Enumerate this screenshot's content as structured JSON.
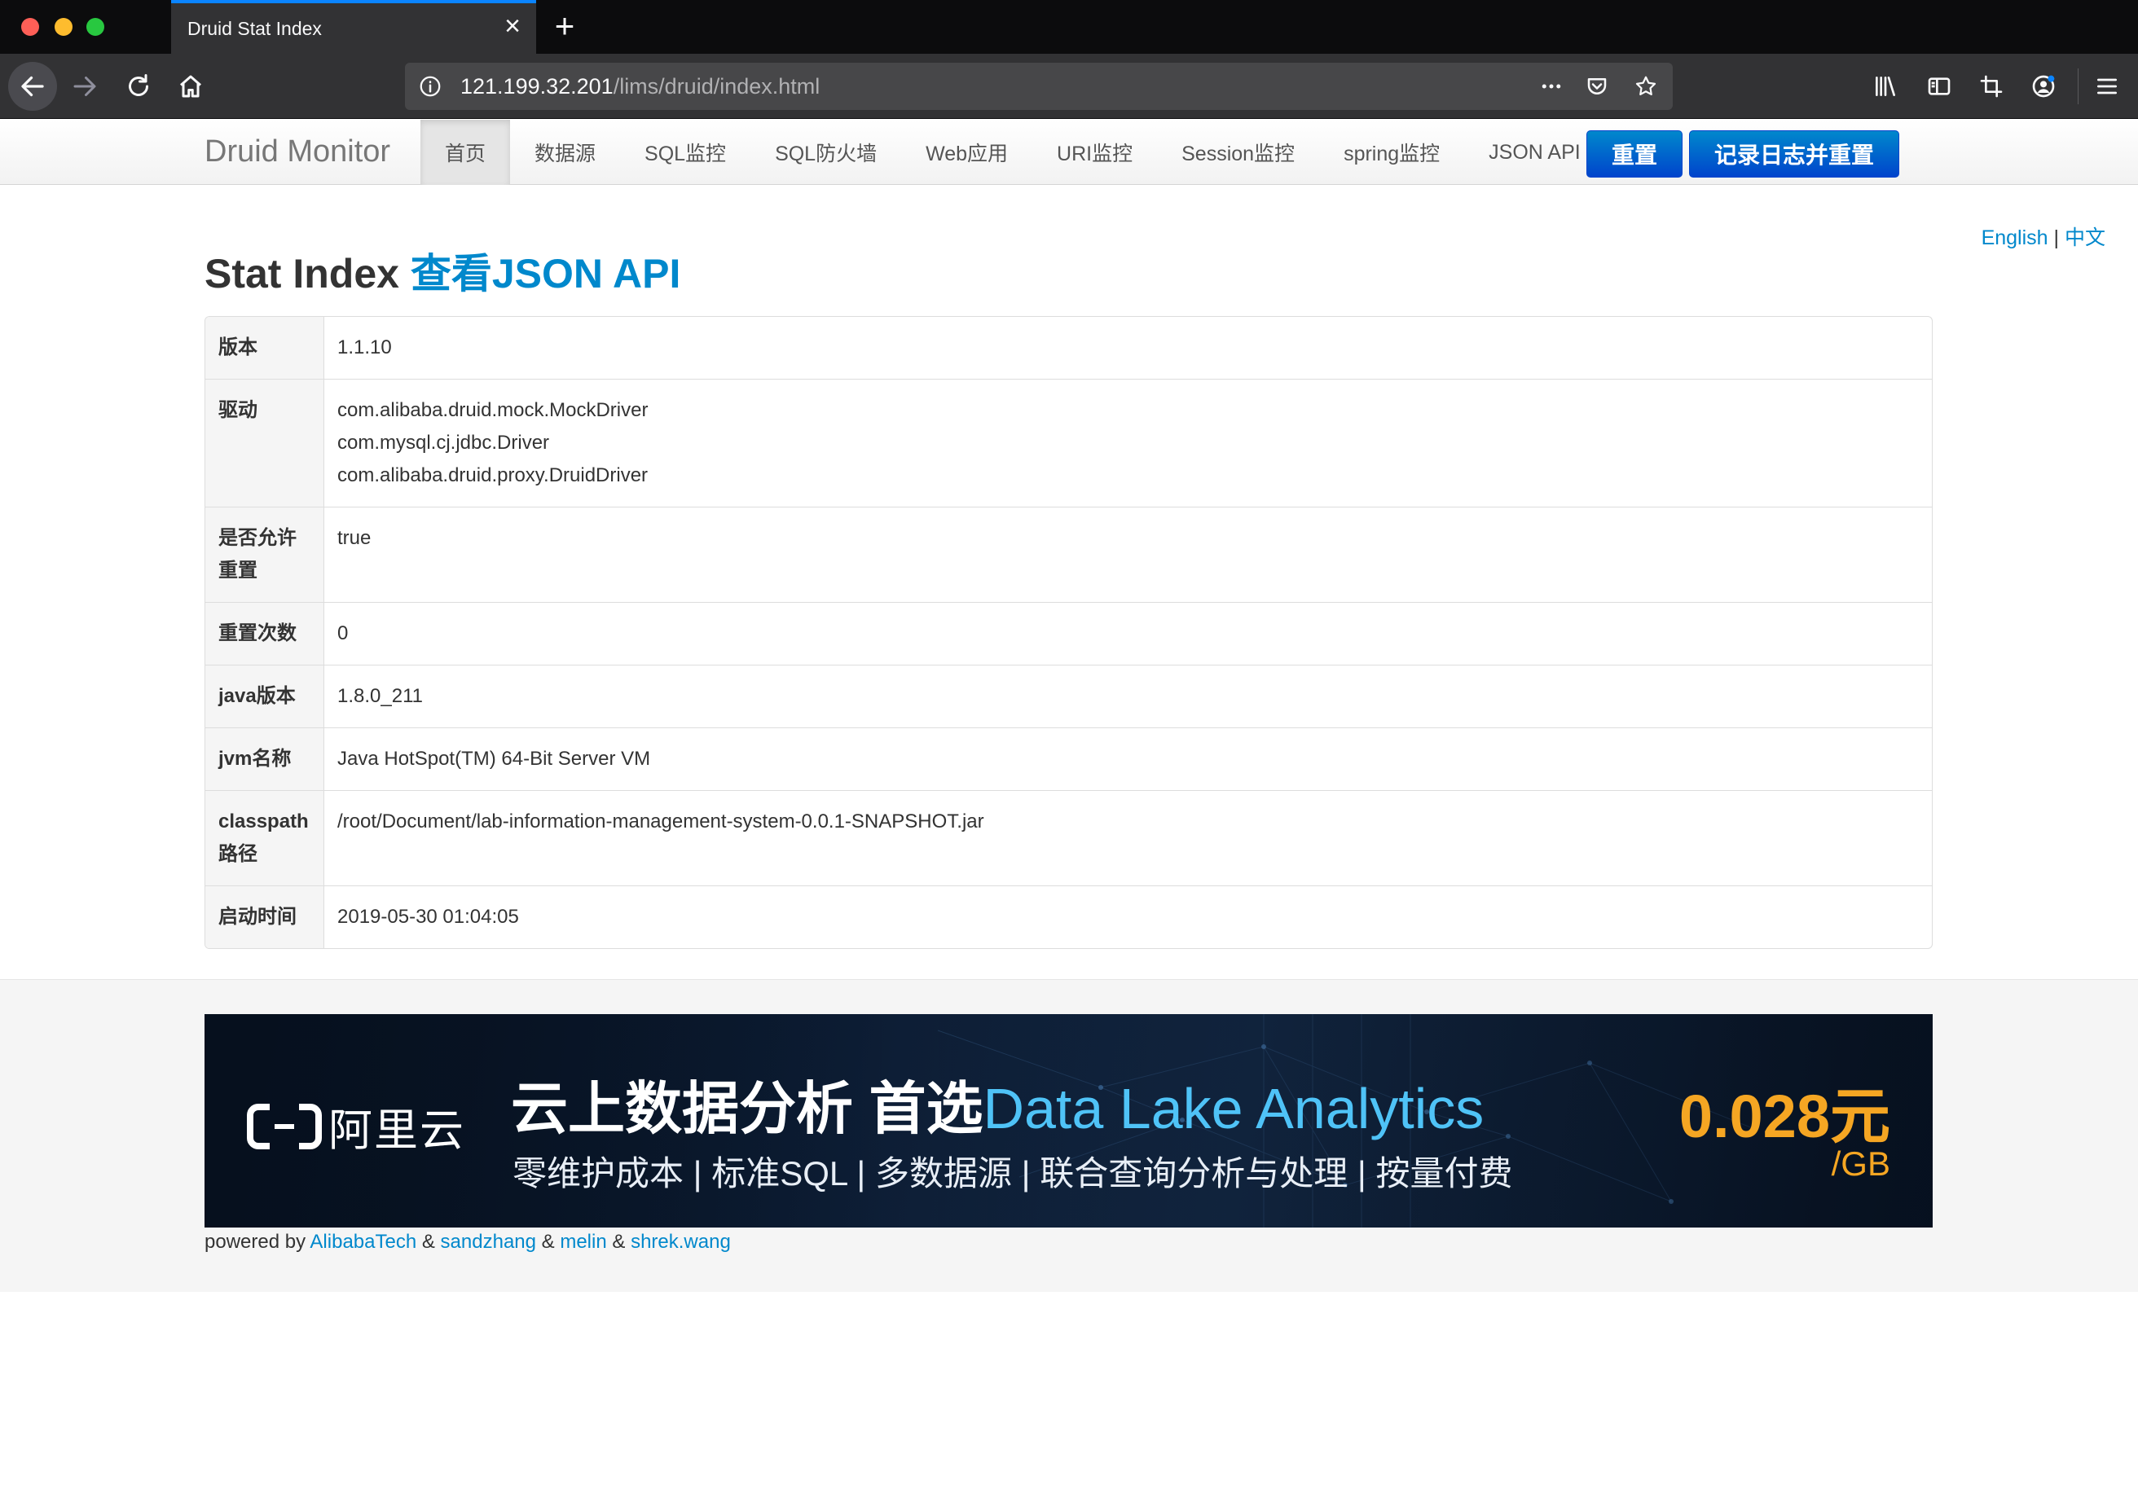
{
  "browser": {
    "tab_title": "Druid Stat Index",
    "url_host": "121.199.32.201",
    "url_path": "/lims/druid/index.html"
  },
  "site": {
    "brand": "Druid Monitor",
    "nav": [
      "首页",
      "数据源",
      "SQL监控",
      "SQL防火墙",
      "Web应用",
      "URI监控",
      "Session监控",
      "spring监控",
      "JSON API"
    ],
    "reset_label": "重置",
    "log_reset_label": "记录日志并重置"
  },
  "lang": {
    "english": "English",
    "separator": "|",
    "chinese": "中文"
  },
  "page": {
    "title_static": "Stat Index",
    "title_link": "查看JSON API"
  },
  "stats": [
    {
      "key": "版本",
      "values": [
        "1.1.10"
      ]
    },
    {
      "key": "驱动",
      "values": [
        "com.alibaba.druid.mock.MockDriver",
        "com.mysql.cj.jdbc.Driver",
        "com.alibaba.druid.proxy.DruidDriver"
      ]
    },
    {
      "key": "是否允许重置",
      "values": [
        "true"
      ]
    },
    {
      "key": "重置次数",
      "values": [
        "0"
      ]
    },
    {
      "key": "java版本",
      "values": [
        "1.8.0_211"
      ]
    },
    {
      "key": "jvm名称",
      "values": [
        "Java HotSpot(TM) 64-Bit Server VM"
      ]
    },
    {
      "key": "classpath路径",
      "values": [
        "/root/Document/lab-information-management-system-0.0.1-SNAPSHOT.jar"
      ]
    },
    {
      "key": "启动时间",
      "values": [
        "2019-05-30 01:04:05"
      ]
    }
  ],
  "banner": {
    "logo_text": "阿里云",
    "headline_main": "云上数据分析 首选",
    "headline_highlight": "Data Lake Analytics",
    "subline": "零维护成本 | 标准SQL | 多数据源 | 联合查询分析与处理 | 按量付费",
    "price": "0.028元",
    "unit": "/GB"
  },
  "footer": {
    "powered_by": "powered by",
    "amp": "&",
    "credits": [
      "AlibabaTech",
      "sandzhang",
      "melin",
      "shrek.wang"
    ]
  },
  "colors": {
    "link": "#0088cc",
    "primary_button": "#0044cc",
    "tab_accent": "#0a84ff",
    "price": "#f5a623"
  }
}
